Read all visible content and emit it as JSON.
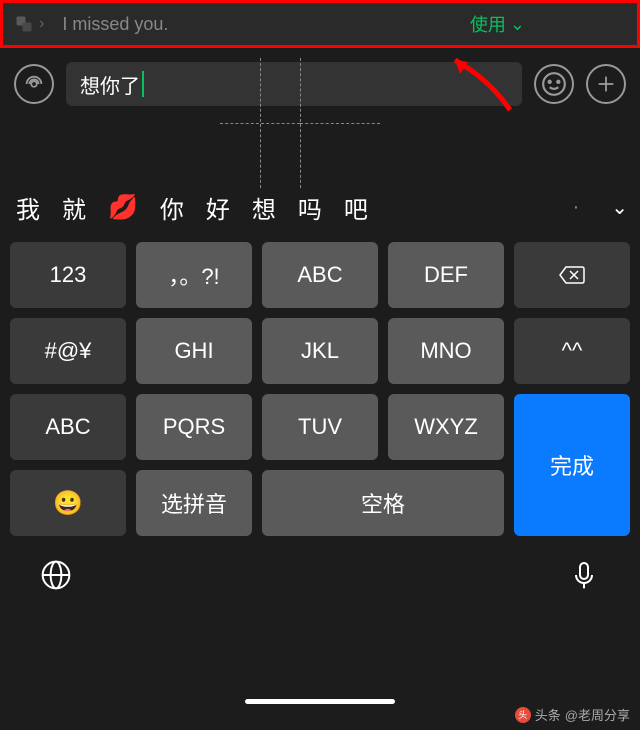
{
  "translation": {
    "text": "I missed you.",
    "use_label": "使用"
  },
  "input": {
    "value": "想你了"
  },
  "candidates": [
    "我",
    "就",
    "💋",
    "你",
    "好",
    "想",
    "吗",
    "吧"
  ],
  "keyboard": {
    "rows": [
      [
        "123",
        "，。?!",
        "ABC",
        "DEF",
        "⌫"
      ],
      [
        "#@¥",
        "GHI",
        "JKL",
        "MNO",
        "^^"
      ],
      [
        "ABC",
        "PQRS",
        "TUV",
        "WXYZ"
      ],
      [
        "😀",
        "选拼音",
        "空格"
      ]
    ],
    "enter_label": "完成"
  },
  "watermark": {
    "brand": "头条",
    "author": "@老周分享"
  }
}
